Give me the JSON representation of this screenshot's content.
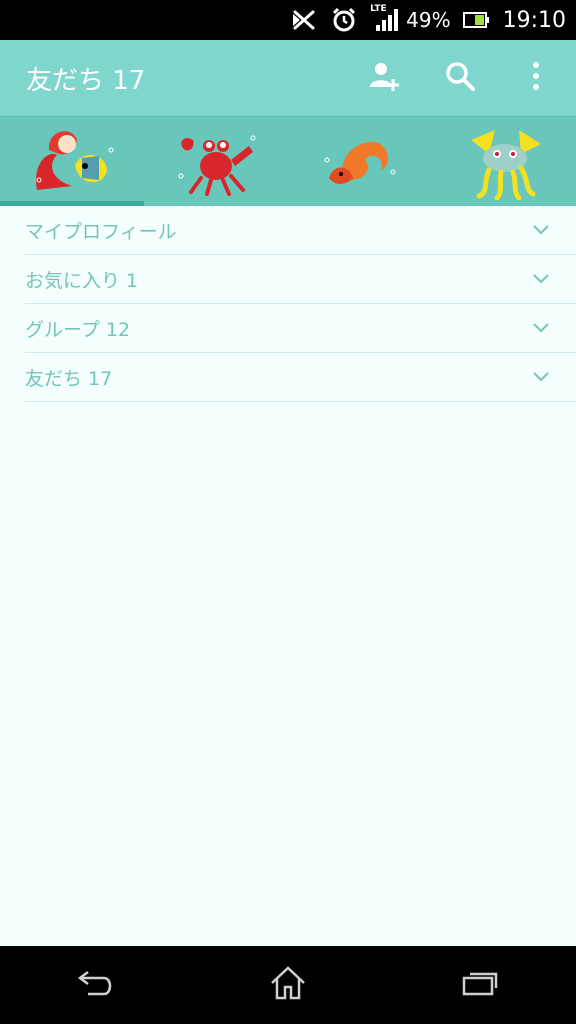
{
  "status_bar": {
    "battery_text": "49%",
    "time": "19:10",
    "network_label": "LTE",
    "icons": [
      "nfc-off-icon",
      "alarm-icon",
      "lte-signal-icon",
      "battery-icon"
    ]
  },
  "app_bar": {
    "title": "友だち 17",
    "actions": [
      "add-friend-icon",
      "search-icon",
      "overflow-menu-icon"
    ]
  },
  "tabs": [
    {
      "name": "ariel-flounder",
      "selected": true
    },
    {
      "name": "sebastian-crab",
      "selected": false
    },
    {
      "name": "hermit-crab",
      "selected": false
    },
    {
      "name": "yellow-fish",
      "selected": false
    }
  ],
  "groups": [
    {
      "label": "マイプロフィール"
    },
    {
      "label": "お気に入り 1"
    },
    {
      "label": "グループ 12"
    },
    {
      "label": "友だち 17"
    }
  ],
  "nav_bar": {
    "buttons": [
      "back-icon",
      "home-icon",
      "recent-apps-icon"
    ]
  },
  "colors": {
    "app_bar": "#7fd6cc",
    "tab_strip": "#68c6ba",
    "accent_text": "#74c4ba",
    "background": "#f4fffd"
  }
}
